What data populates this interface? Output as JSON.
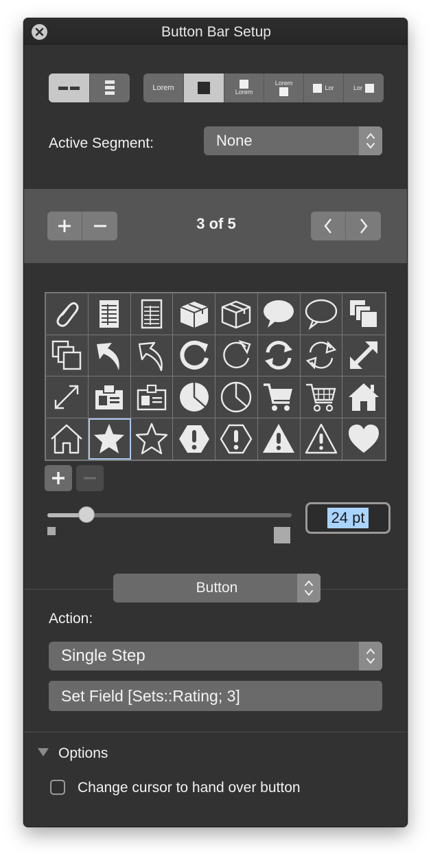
{
  "window": {
    "title": "Button Bar Setup"
  },
  "layout_segments": [
    {
      "name": "horizontal-layout",
      "selected": true
    },
    {
      "name": "vertical-layout",
      "selected": false
    }
  ],
  "label_segments": [
    {
      "text": "Lorem",
      "kind": "text-only",
      "selected": false
    },
    {
      "text": "",
      "kind": "icon-only",
      "selected": true
    },
    {
      "text": "Lorem",
      "kind": "icon-above-text",
      "selected": false
    },
    {
      "text": "Lorem",
      "kind": "text-above-icon",
      "selected": false
    },
    {
      "text": "Lor",
      "kind": "icon-left-text",
      "selected": false
    },
    {
      "text": "Lor",
      "kind": "text-left-icon",
      "selected": false
    }
  ],
  "active_segment": {
    "label": "Active Segment:",
    "value": "None"
  },
  "navigation": {
    "counter": "3 of 5"
  },
  "icon_grid": {
    "selected_index": 25,
    "icons": [
      "paperclip-icon",
      "spreadsheet-filled-icon",
      "spreadsheet-outline-icon",
      "box-filled-icon",
      "box-outline-icon",
      "speech-bubble-filled-icon",
      "speech-bubble-outline-icon",
      "stack-filled-icon",
      "stack-outline-icon",
      "arrow-up-left-filled-icon",
      "arrow-up-left-outline-icon",
      "rotate-filled-icon",
      "rotate-outline-icon",
      "sync-filled-icon",
      "sync-outline-icon",
      "expand-filled-icon",
      "expand-outline-icon",
      "id-card-filled-icon",
      "id-card-outline-icon",
      "pie-chart-filled-icon",
      "pie-chart-outline-icon",
      "cart-filled-icon",
      "cart-outline-icon",
      "home-filled-icon",
      "home-outline-icon",
      "star-filled-icon",
      "star-outline-icon",
      "hexagon-alert-filled-icon",
      "hexagon-alert-outline-icon",
      "triangle-warning-filled-icon",
      "triangle-warning-outline-icon",
      "heart-filled-icon"
    ]
  },
  "icon_size": {
    "value": "24",
    "unit": " pt",
    "slider_fraction": 0.16
  },
  "type_popup": {
    "value": "Button"
  },
  "action": {
    "label": "Action:",
    "value": "Single Step",
    "script_step": "Set Field [Sets::Rating; 3]"
  },
  "options": {
    "label": "Options",
    "change_cursor": {
      "label": "Change cursor to hand over button",
      "checked": false
    }
  },
  "colors": {
    "window_bg": "#323232",
    "band_bg": "#555555",
    "control": "#6a6a6a",
    "selection": "#a9d4ff",
    "focus_ring": "#a9c8ee"
  }
}
